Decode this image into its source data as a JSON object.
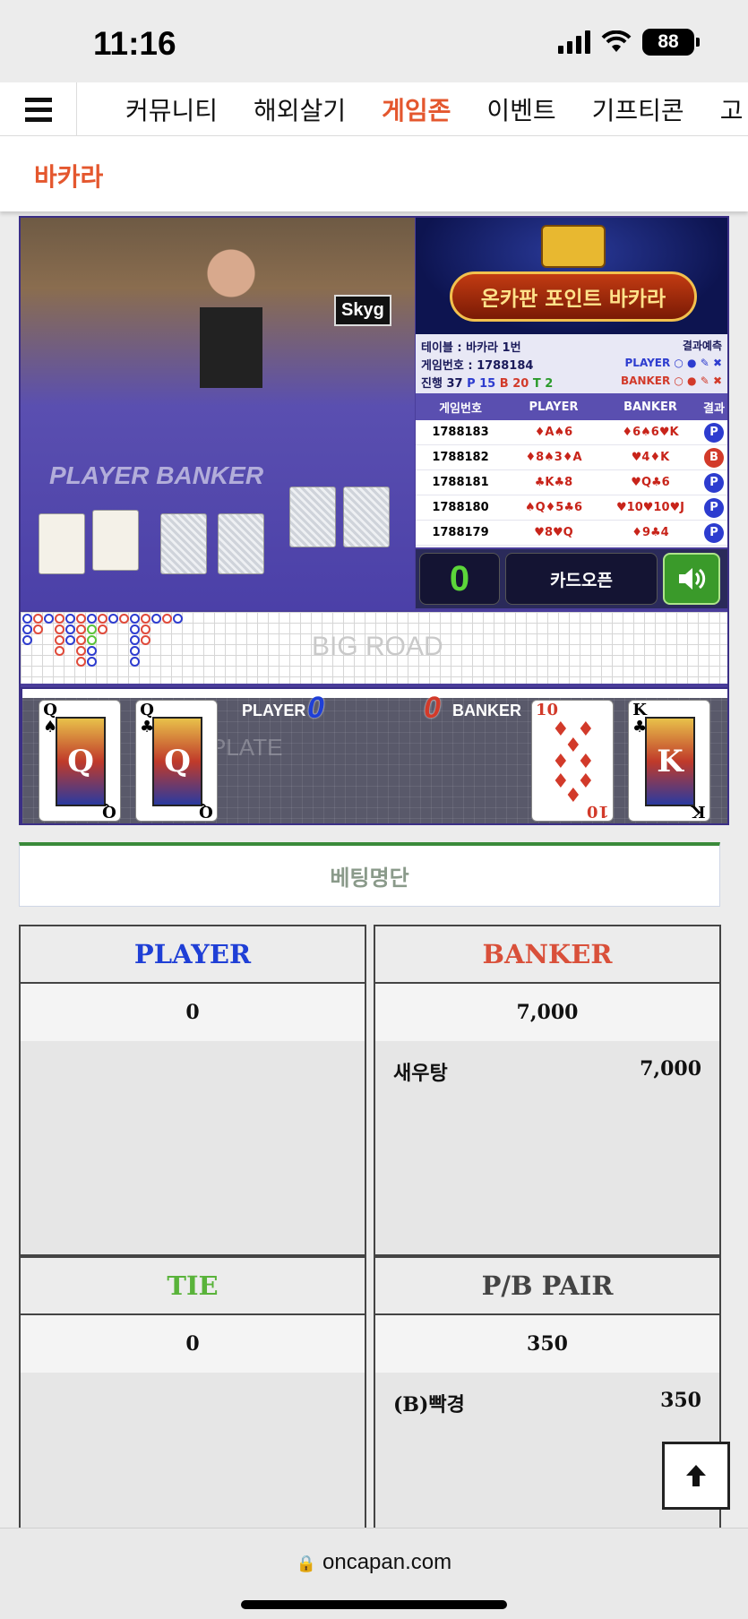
{
  "status": {
    "time": "11:16",
    "battery": "88"
  },
  "nav": {
    "items": [
      {
        "label": "커뮤니티",
        "active": false
      },
      {
        "label": "해외살기",
        "active": false
      },
      {
        "label": "게임존",
        "active": true
      },
      {
        "label": "이벤트",
        "active": false
      },
      {
        "label": "기프티콘",
        "active": false
      },
      {
        "label": "고",
        "active": false
      }
    ]
  },
  "page": {
    "title": "바카라"
  },
  "game": {
    "video": {
      "sign": "Skyg",
      "felt_label": "PLAYER  BANKER"
    },
    "promo": {
      "title": "온카판 포인트 바카라"
    },
    "info": {
      "table_label": "테이블 : 바카라 1번",
      "game_no_label": "게임번호 : 1788184",
      "progress_label": "진행 37",
      "p_count": "P 15",
      "b_count": "B 20",
      "t_count": "T 2",
      "prediction_title": "결과예측",
      "player_pred": "PLAYER",
      "banker_pred": "BANKER"
    },
    "history": {
      "headers": [
        "게임번호",
        "PLAYER",
        "BANKER",
        "결과"
      ],
      "rows": [
        {
          "no": "1788183",
          "player": "♦A♠6",
          "banker": "♦6♠6♥K",
          "result": "P"
        },
        {
          "no": "1788182",
          "player": "♦8♠3♦A",
          "banker": "♥4♦K",
          "result": "B"
        },
        {
          "no": "1788181",
          "player": "♣K♣8",
          "banker": "♥Q♣6",
          "result": "P"
        },
        {
          "no": "1788180",
          "player": "♠Q♦5♣6",
          "banker": "♥10♥10♥J",
          "result": "P"
        },
        {
          "no": "1788179",
          "player": "♥8♥Q",
          "banker": "♦9♣4",
          "result": "P"
        }
      ]
    },
    "controls": {
      "count": "0",
      "open_label": "카드오픈",
      "sound_icon": "speaker-icon"
    },
    "bigroad_label": "BIG ROAD",
    "cards": {
      "plate_label": "PLATE",
      "player_label": "PLAYER",
      "player_score": "0",
      "banker_label": "BANKER",
      "banker_score": "0",
      "player_cards": [
        {
          "rank": "Q",
          "suit": "♠"
        },
        {
          "rank": "Q",
          "suit": "♣"
        }
      ],
      "banker_cards": [
        {
          "rank": "10",
          "suit": "♦"
        },
        {
          "rank": "K",
          "suit": "♣"
        }
      ]
    }
  },
  "betting": {
    "title": "베팅명단",
    "panels": [
      {
        "name": "PLAYER",
        "color": "#1f3fd6",
        "total": "0",
        "entries": []
      },
      {
        "name": "BANKER",
        "color": "#d9503a",
        "total": "7,000",
        "entries": [
          {
            "user": "새우탕",
            "amount": "7,000"
          }
        ]
      },
      {
        "name": "TIE",
        "color": "#59b33a",
        "total": "0",
        "entries": []
      },
      {
        "name": "P/B PAIR",
        "color": "#444444",
        "total": "350",
        "entries": [
          {
            "user": "(B)빡경",
            "amount": "350"
          }
        ]
      }
    ]
  },
  "browser": {
    "url": "oncapan.com"
  }
}
